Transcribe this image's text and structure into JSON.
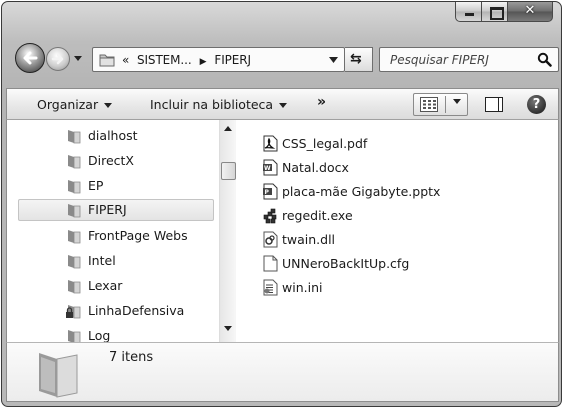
{
  "address": {
    "overflow": "«",
    "segments": [
      "SISTEM...",
      "FIPERJ"
    ]
  },
  "search": {
    "placeholder": "Pesquisar FIPERJ"
  },
  "toolbar": {
    "organize": "Organizar",
    "include": "Incluir na biblioteca",
    "more": "»"
  },
  "nav": {
    "items": [
      {
        "label": "dialhost"
      },
      {
        "label": "DirectX"
      },
      {
        "label": "EP"
      },
      {
        "label": "FIPERJ",
        "selected": true
      },
      {
        "label": "FrontPage Webs"
      },
      {
        "label": "Intel"
      },
      {
        "label": "Lexar"
      },
      {
        "label": "LinhaDefensiva",
        "locked": true
      },
      {
        "label": "Log"
      }
    ]
  },
  "files": [
    {
      "name": "CSS_legal.pdf",
      "icon": "pdf-icon"
    },
    {
      "name": "Natal.docx",
      "icon": "word-document-icon"
    },
    {
      "name": "placa-mãe Gigabyte.pptx",
      "icon": "powerpoint-icon"
    },
    {
      "name": "regedit.exe",
      "icon": "regedit-icon"
    },
    {
      "name": "twain.dll",
      "icon": "dll-icon"
    },
    {
      "name": "UNNeroBackItUp.cfg",
      "icon": "blank-file-icon"
    },
    {
      "name": "win.ini",
      "icon": "ini-file-icon"
    }
  ],
  "details": {
    "count": "7 itens"
  }
}
